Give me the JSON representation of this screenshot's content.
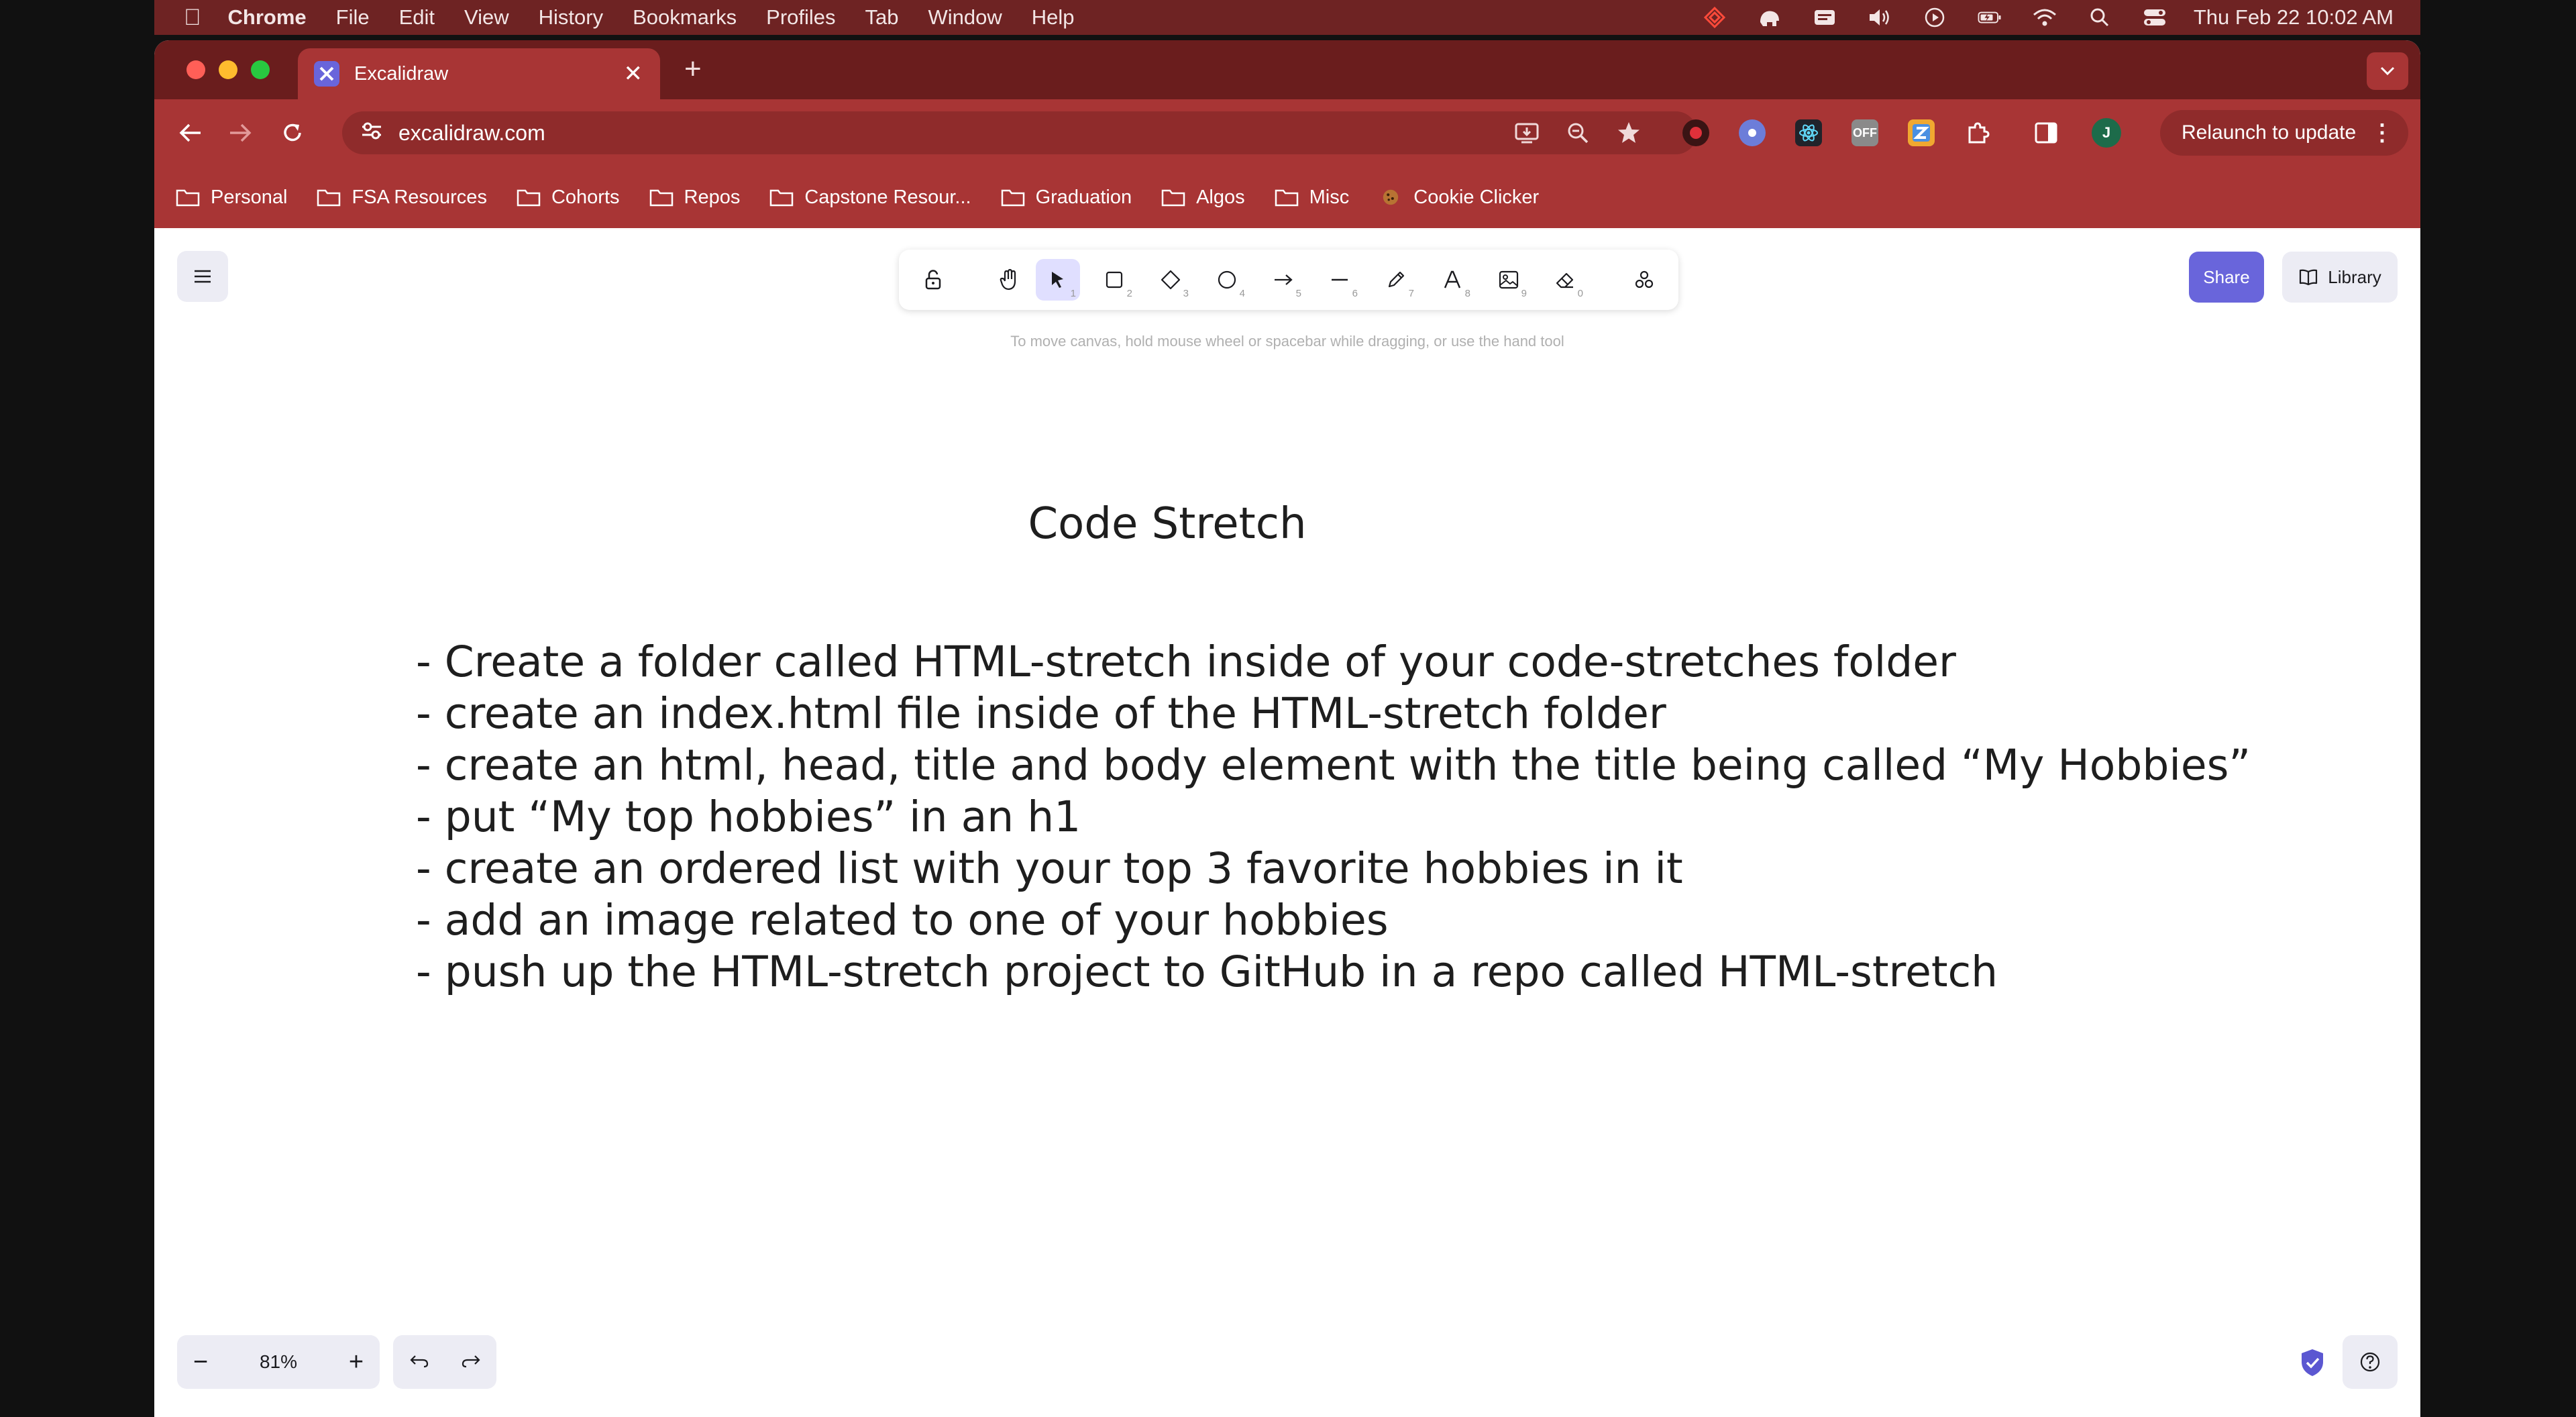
{
  "menubar": {
    "app": "Chrome",
    "items": [
      "File",
      "Edit",
      "View",
      "History",
      "Bookmarks",
      "Profiles",
      "Tab",
      "Window",
      "Help"
    ],
    "clock": "Thu Feb 22  10:02 AM"
  },
  "browser": {
    "tab_title": "Excalidraw",
    "url": "excalidraw.com",
    "relaunch_label": "Relaunch to update",
    "profile_initial": "J",
    "ext_off_label": "OFF",
    "bookmarks": [
      "Personal",
      "FSA Resources",
      "Cohorts",
      "Repos",
      "Capstone Resour...",
      "Graduation",
      "Algos",
      "Misc",
      "Cookie Clicker"
    ]
  },
  "excalidraw": {
    "hint": "To move canvas, hold mouse wheel or spacebar while dragging, or use the hand tool",
    "share_label": "Share",
    "library_label": "Library",
    "zoom": "81%",
    "tools": [
      "lock",
      "hand",
      "selection",
      "rectangle",
      "diamond",
      "ellipse",
      "arrow",
      "line",
      "draw",
      "text",
      "image",
      "eraser",
      "extra-tools"
    ],
    "tool_keys": [
      "1",
      "2",
      "3",
      "4",
      "5",
      "6",
      "7",
      "8",
      "9",
      "0"
    ],
    "active_tool": "selection"
  },
  "canvas": {
    "title": "Code Stretch",
    "notes": [
      "- Create a folder called HTML-stretch inside of your code-stretches folder",
      "- create an index.html file inside of the HTML-stretch folder",
      "- create an html, head, title and body element with the title being called “My Hobbies”",
      "- put “My top hobbies” in an h1",
      "- create an ordered list with your top 3 favorite hobbies in it",
      "- add an image related to one of your hobbies",
      "- push up the HTML-stretch project to GitHub in a repo called HTML-stretch"
    ]
  },
  "colors": {
    "tab_strip": "#6a1d1d",
    "toolbar": "#a83535",
    "accent": "#6965db",
    "active_tool_bg": "#e0dfff"
  }
}
